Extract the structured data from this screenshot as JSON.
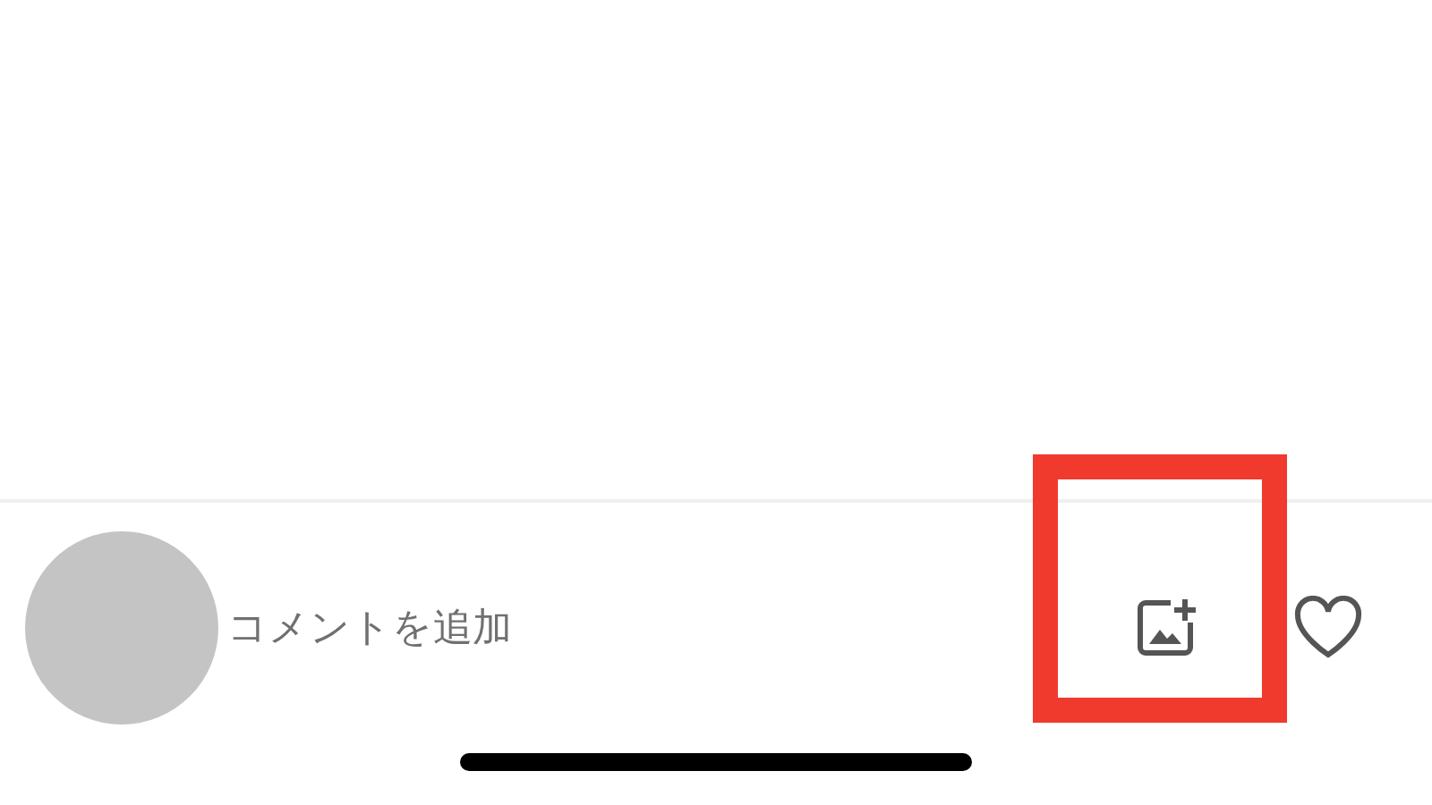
{
  "comment_bar": {
    "placeholder": "コメントを追加",
    "add_image_button": {
      "highlighted": true
    },
    "like_button": {
      "liked": false
    }
  }
}
